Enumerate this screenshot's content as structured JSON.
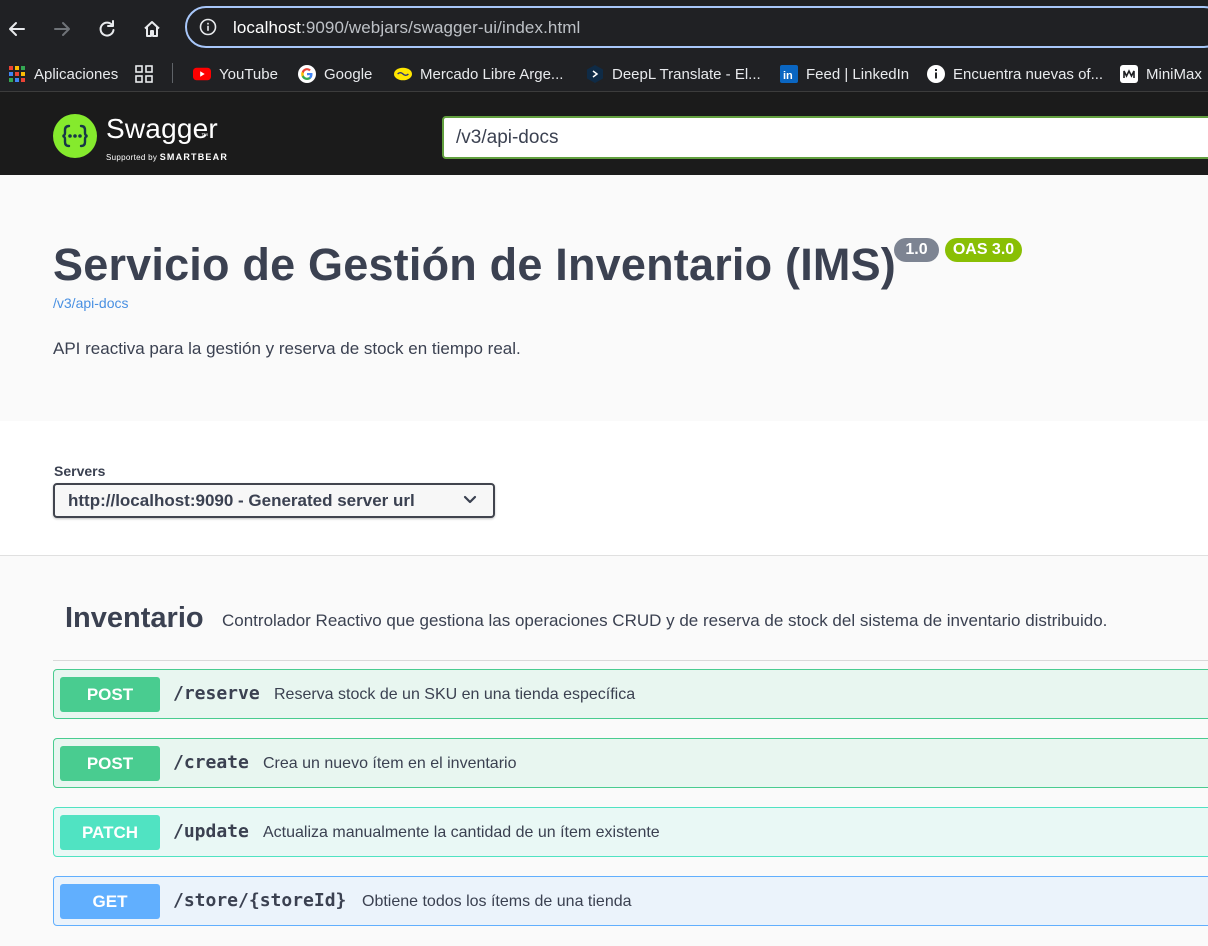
{
  "browser": {
    "url_host": "localhost",
    "url_rest": ":9090/webjars/swagger-ui/index.html",
    "bookmarks": [
      {
        "label": "Aplicaciones",
        "icon": "apps-grid-icon"
      },
      {
        "label": "",
        "icon": "grid-icon"
      },
      {
        "label": "YouTube",
        "icon": "youtube-icon"
      },
      {
        "label": "Google",
        "icon": "google-icon"
      },
      {
        "label": "Mercado Libre Arge...",
        "icon": "mercadolibre-icon"
      },
      {
        "label": "DeepL Translate - El...",
        "icon": "deepl-icon"
      },
      {
        "label": "Feed | LinkedIn",
        "icon": "linkedin-icon"
      },
      {
        "label": "Encuentra nuevas of...",
        "icon": "info-circle-icon"
      },
      {
        "label": "MiniMax",
        "icon": "minimax-icon"
      }
    ]
  },
  "swagger": {
    "brand": "Swagger",
    "tm": "™",
    "supported_by": "Supported by",
    "smartbear": "SMARTBEAR",
    "spec_url_input": "/v3/api-docs"
  },
  "info": {
    "title": "Servicio de Gestión de Inventario (IMS)",
    "version": "1.0",
    "oas": "OAS 3.0",
    "spec_link": "/v3/api-docs",
    "description": "API reactiva para la gestión y reserva de stock en tiempo real."
  },
  "servers": {
    "label": "Servers",
    "selected": "http://localhost:9090 - Generated server url"
  },
  "tag": {
    "name": "Inventario",
    "description": "Controlador Reactivo que gestiona las operaciones CRUD y de reserva de stock del sistema de inventario distribuido."
  },
  "operations": [
    {
      "method": "POST",
      "path": "/reserve",
      "summary": "Reserva stock de un SKU en una tienda específica"
    },
    {
      "method": "POST",
      "path": "/create",
      "summary": "Crea un nuevo ítem en el inventario"
    },
    {
      "method": "PATCH",
      "path": "/update",
      "summary": "Actualiza manualmente la cantidad de un ítem existente"
    },
    {
      "method": "GET",
      "path": "/store/{storeId}",
      "summary": "Obtiene todos los ítems de una tienda"
    }
  ],
  "colors": {
    "post": "#49cc90",
    "patch": "#50e3c2",
    "get": "#61affe",
    "swagger_green": "#85ea2d",
    "oas_badge": "#89bf04",
    "version_badge": "#7d8492"
  }
}
